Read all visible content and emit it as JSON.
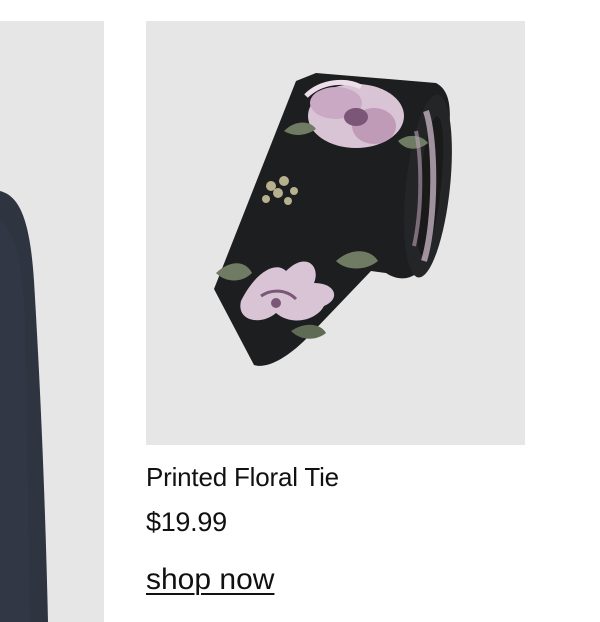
{
  "previous_product": {
    "image_description": "partial grey fabric",
    "background_color": "#e6e6e6",
    "fabric_color": "#2f3441"
  },
  "product": {
    "name": "Printed Floral Tie",
    "price": "$19.99",
    "cta_label": "shop now",
    "image_background": "#e6e6e6",
    "tie_base_color": "#1d1e1f",
    "floral_color": "#d9c4d6",
    "leaf_color": "#6f7c63"
  }
}
